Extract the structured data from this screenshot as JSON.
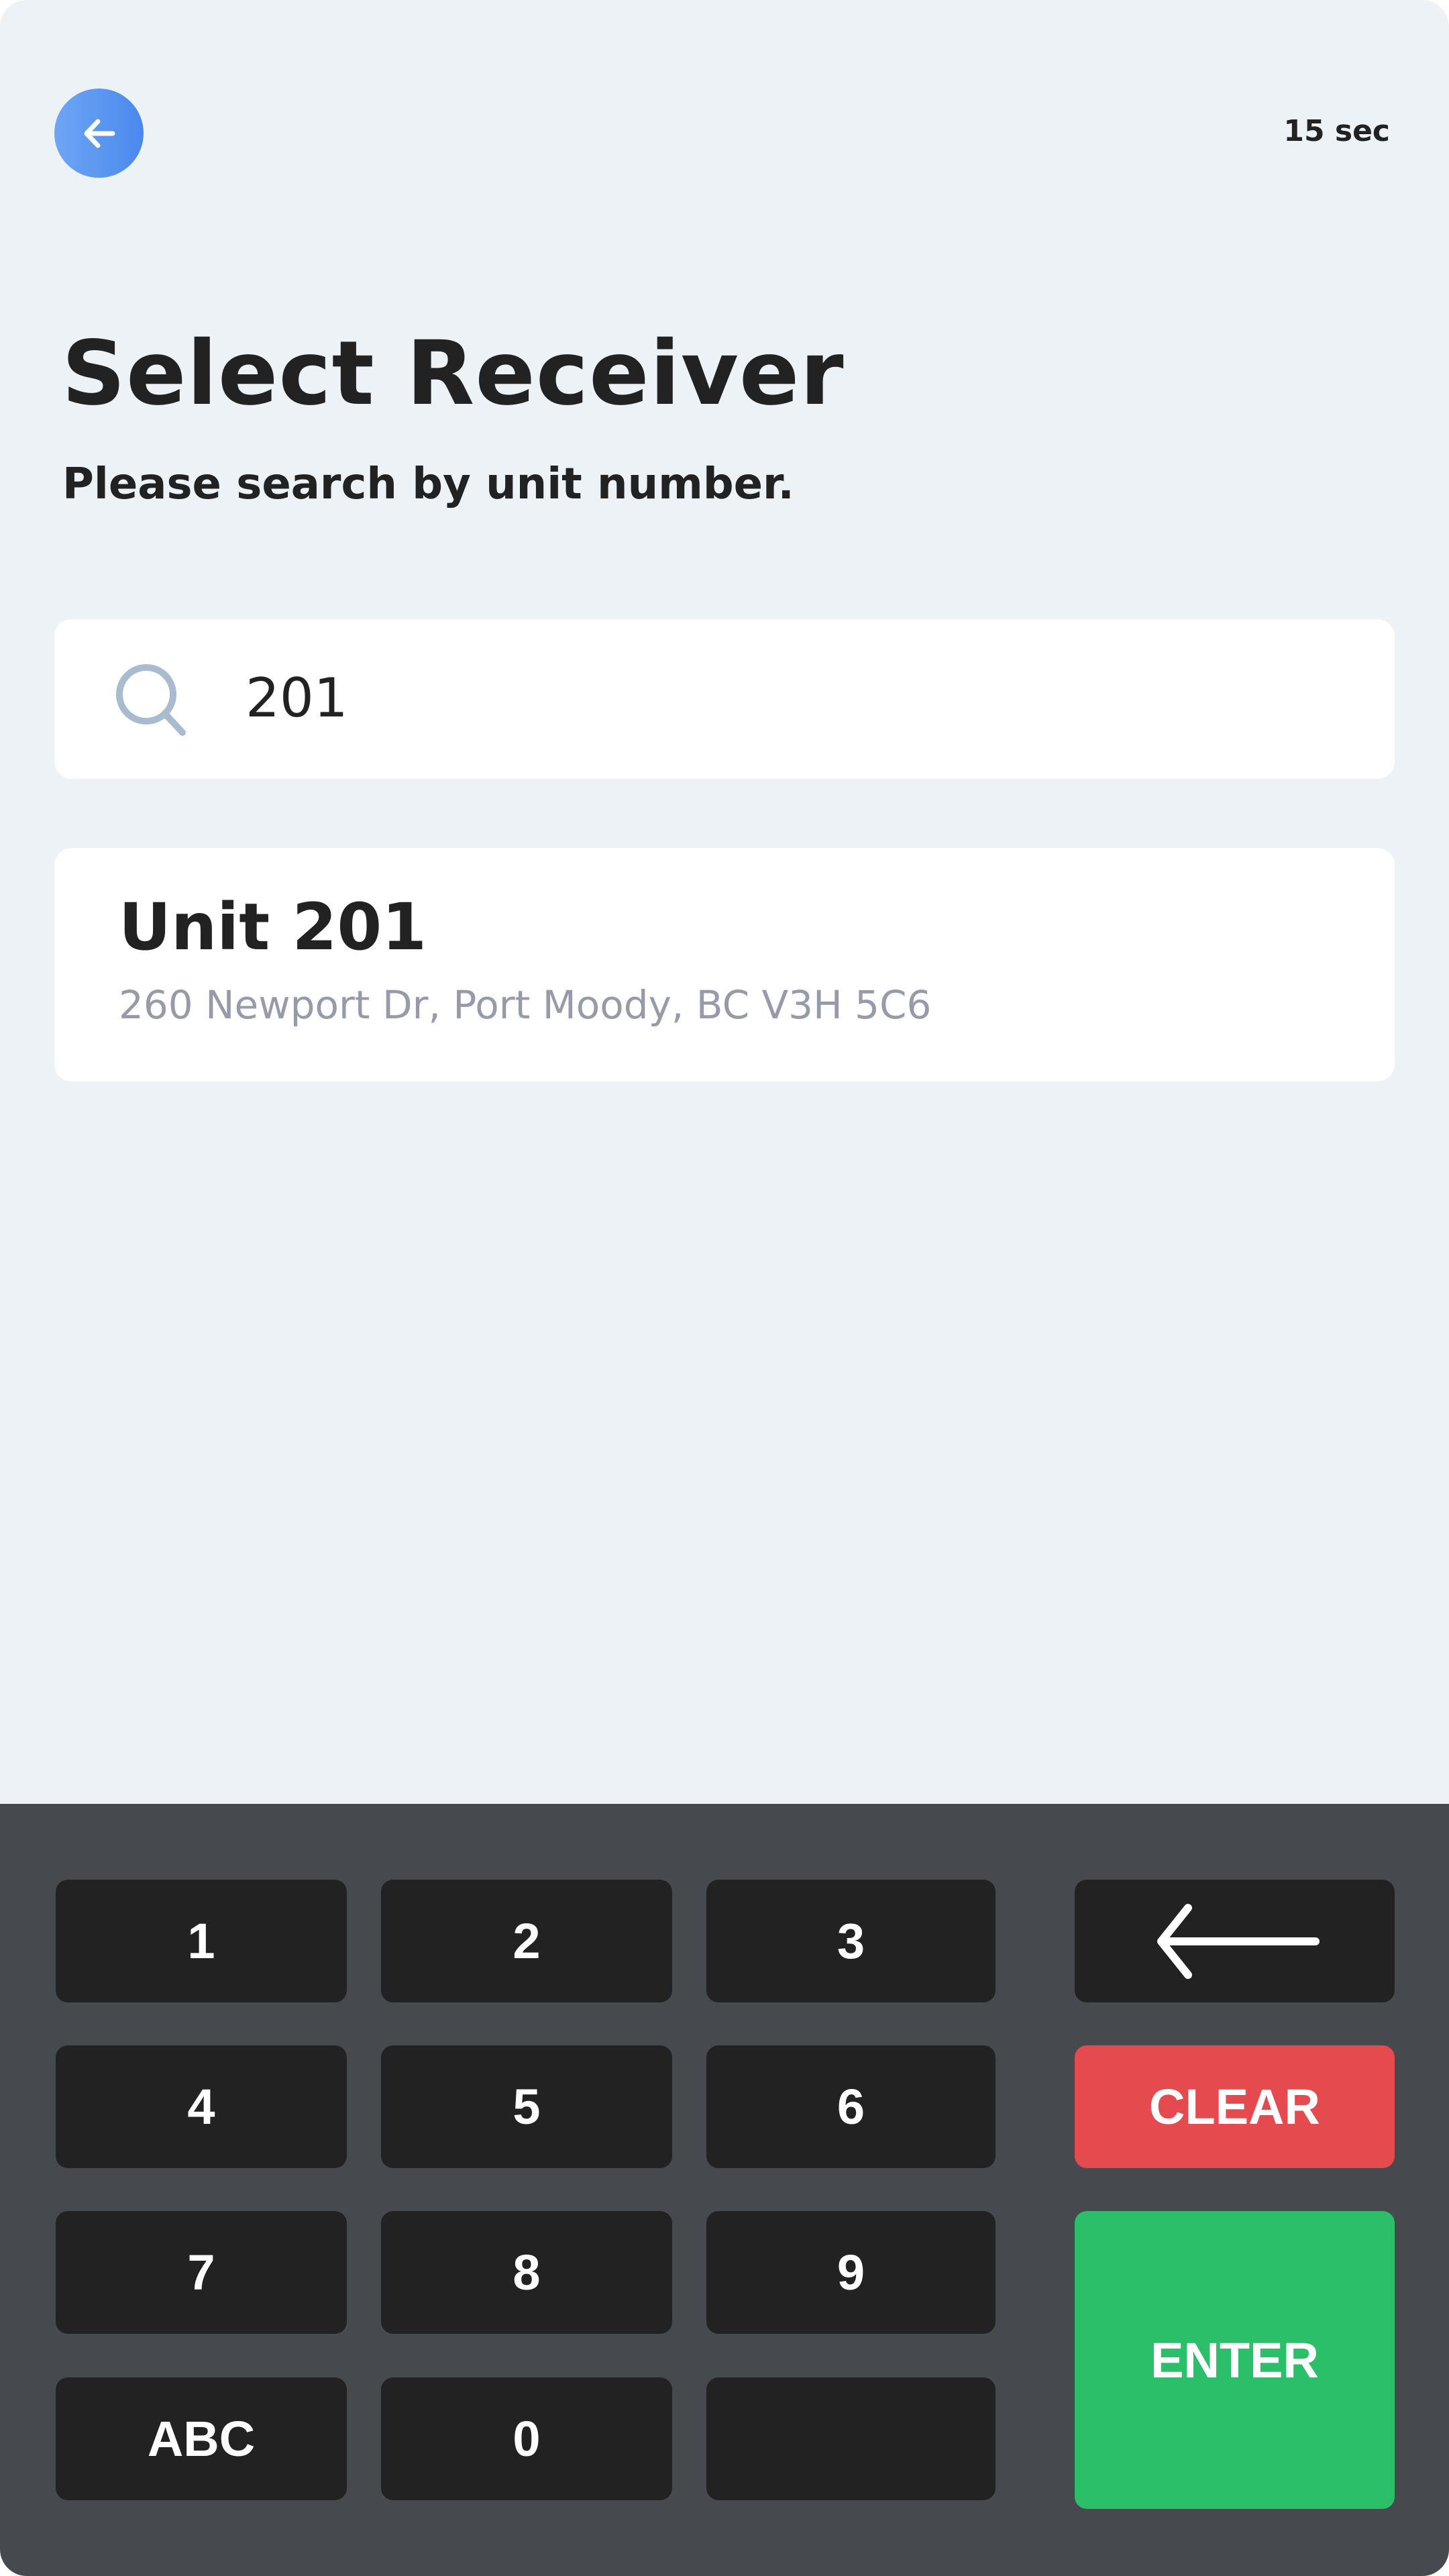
{
  "header": {
    "back_icon": "arrow-left-icon",
    "timer": "15 sec"
  },
  "title": "Select Receiver",
  "subtitle": "Please search by unit number.",
  "search": {
    "icon": "search-icon",
    "value": "201",
    "placeholder": ""
  },
  "results": [
    {
      "unit": "Unit 201",
      "address": "260 Newport Dr, Port Moody, BC V3H 5C6"
    }
  ],
  "keypad": {
    "keys": [
      "1",
      "2",
      "3",
      "4",
      "5",
      "6",
      "7",
      "8",
      "9",
      "ABC",
      "0",
      ""
    ],
    "backspace_icon": "backspace-arrow-icon",
    "clear": "CLEAR",
    "enter": "ENTER"
  },
  "colors": {
    "background": "#edf2f7",
    "accent": "#4a88ec",
    "keypad_bg": "#464a4f",
    "key": "#222222",
    "clear": "#e54a4f",
    "enter": "#2cbf69",
    "address": "#979aa8"
  }
}
